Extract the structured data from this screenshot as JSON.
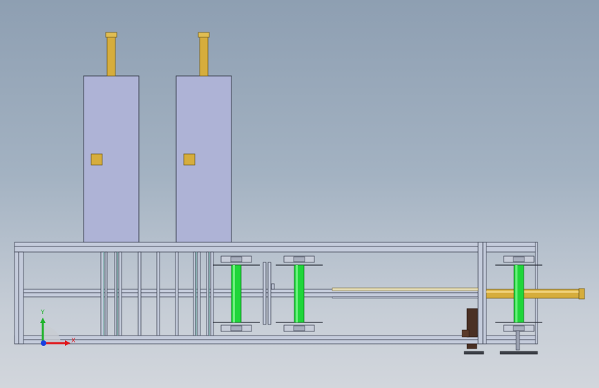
{
  "viewport": {
    "background_top": "#8e9fb2",
    "background_bottom": "#d2d6dc"
  },
  "model": {
    "colors": {
      "frame_fill": "#c4cbdb",
      "frame_stroke": "#3b4050",
      "tank_fill": "#aeb3d6",
      "brass": "#d6ad3c",
      "roller_green": "#1fd63a",
      "flange_fill": "#c7ccd8",
      "motor_brown": "#4a3024"
    },
    "tanks": [
      {
        "name": "tank-left"
      },
      {
        "name": "tank-right"
      }
    ],
    "rollers": [
      {
        "name": "roller-1"
      },
      {
        "name": "roller-2"
      },
      {
        "name": "roller-3"
      }
    ]
  },
  "triad": {
    "y_label": "Y",
    "x_label": "X",
    "y_color": "#1fb32b",
    "x_color": "#e0161b",
    "z_color": "#1a3fe0"
  }
}
